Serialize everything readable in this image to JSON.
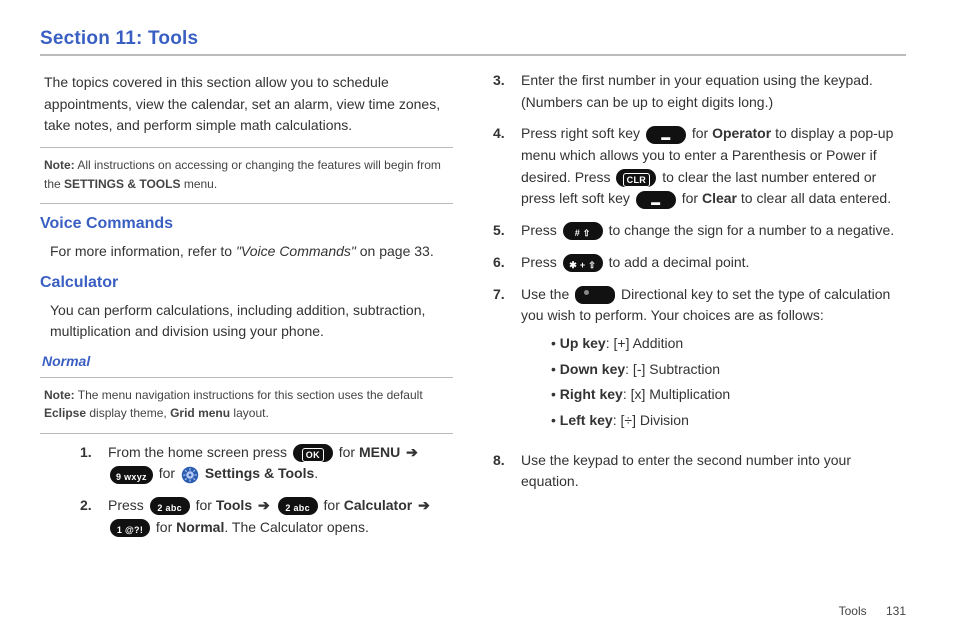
{
  "title": "Section 11: Tools",
  "intro": "The topics covered in this section allow you to schedule appointments, view the calendar, set an alarm, view time zones, take notes, and perform simple math calculations.",
  "note1": {
    "label": "Note:",
    "text_a": " All instructions on accessing or changing the features will begin from the ",
    "bold": "SETTINGS & TOOLS",
    "text_b": " menu."
  },
  "h_voice": "Voice Commands",
  "voice_p_a": "For more information, refer to ",
  "voice_ref": "\"Voice Commands\"",
  "voice_p_b": "  on page 33.",
  "h_calc": "Calculator",
  "calc_p": "You can perform calculations, including addition, subtraction, multiplication and division using your phone.",
  "h_normal": "Normal",
  "note2": {
    "label": "Note:",
    "text_a": " The menu navigation instructions for this section uses the default ",
    "bold1": "Eclipse",
    "text_b": " display theme, ",
    "bold2": "Grid menu",
    "text_c": " layout."
  },
  "left_steps": {
    "s1": {
      "num": "1.",
      "a": "From the home screen press ",
      "for_menu": " for ",
      "menu": "MENU",
      "for2": " for ",
      "st_label": " Settings & Tools",
      "dot": "."
    },
    "s2": {
      "num": "2.",
      "press": "Press ",
      "for_tools": " for ",
      "tools": "Tools",
      "for_calc": " for ",
      "calc": "Calculator",
      "for_normal": " for ",
      "normal": "Normal",
      "tail": ". The Calculator opens."
    }
  },
  "right_steps": {
    "s3": {
      "num": "3.",
      "t": "Enter the first number in your equation using the keypad. (Numbers can be up to eight digits long.)"
    },
    "s4": {
      "num": "4.",
      "a": "Press right soft key ",
      "b": " for ",
      "op": "Operator",
      "c": " to display a pop-up menu which allows you to enter a Parenthesis or Power if desired. Press ",
      "d": " to clear the last number entered or press left soft key ",
      "e": " for ",
      "clr": "Clear",
      "f": " to clear all data entered."
    },
    "s5": {
      "num": "5.",
      "a": "Press ",
      "b": " to change the sign for a number to a negative."
    },
    "s6": {
      "num": "6.",
      "a": "Press ",
      "b": " to add a decimal point."
    },
    "s7": {
      "num": "7.",
      "a": "Use the ",
      "b": " Directional key to set the type of calculation you wish to perform. Your choices are as follows:"
    },
    "bullets": {
      "up_k": "Up key",
      "up_v": ": [+] Addition",
      "dn_k": "Down key",
      "dn_v": ": [-] Subtraction",
      "rt_k": "Right key",
      "rt_v": ": [x] Multiplication",
      "lt_k": "Left key",
      "lt_v": ": [÷] Division"
    },
    "s8": {
      "num": "8.",
      "t": "Use the keypad to enter the second number into your equation."
    }
  },
  "keys": {
    "ok": "OK",
    "nine": "9 wxyz",
    "two": "2 abc",
    "one": "1 @?!",
    "clr": "CLR",
    "hash": "# ⇧",
    "star": "✱ + ⇧"
  },
  "footer": {
    "label": "Tools",
    "page": "131"
  }
}
